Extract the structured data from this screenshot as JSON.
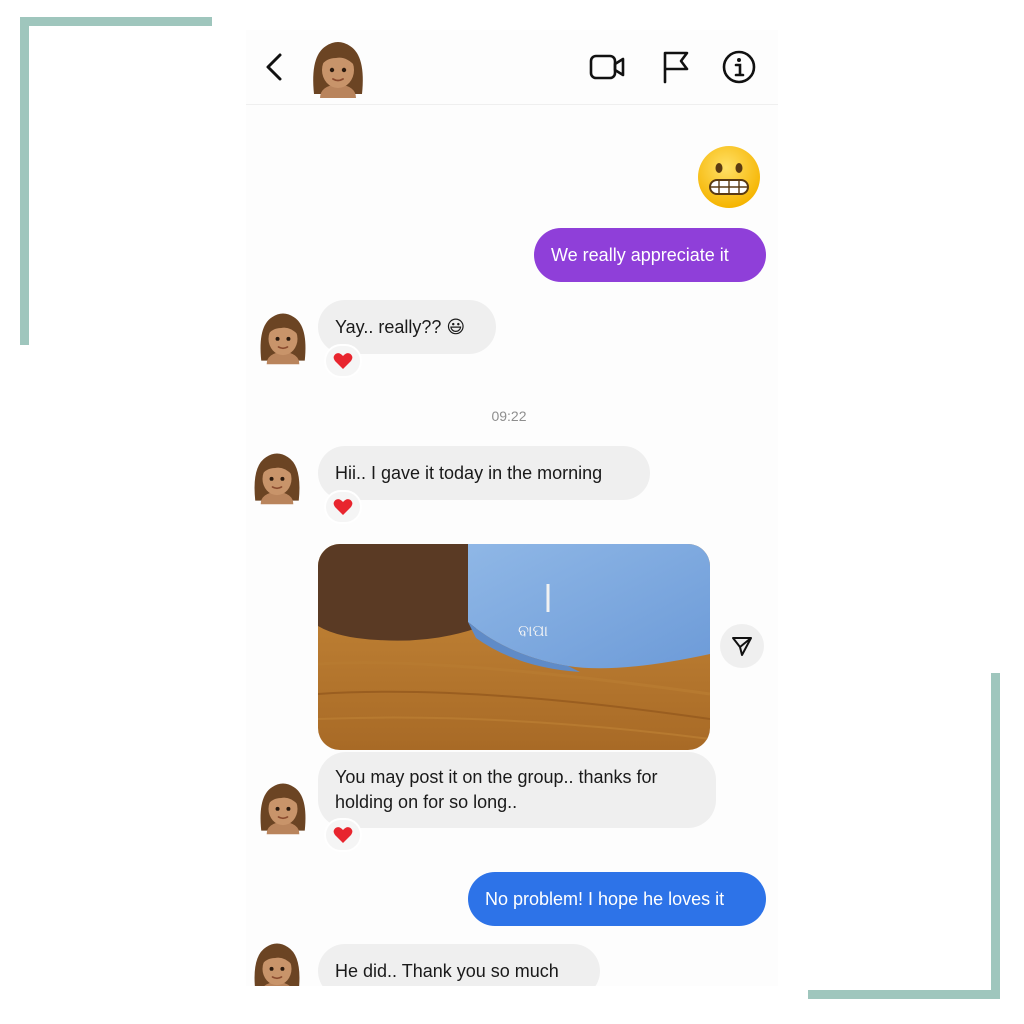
{
  "colors": {
    "frame": "#9fc6bd",
    "purple_bubble": "#8f3fd9",
    "blue_bubble": "#2d73e8",
    "incoming_bubble": "#efefef",
    "heart": "#e8252e"
  },
  "header": {
    "back_icon": "chevron-left-icon",
    "video_icon": "video-camera-icon",
    "flag_icon": "flag-icon",
    "info_icon": "info-icon"
  },
  "messages": [
    {
      "direction": "outgoing",
      "kind": "emoji",
      "emoji": "grimacing-face"
    },
    {
      "direction": "outgoing",
      "text": "We really appreciate it"
    },
    {
      "direction": "incoming",
      "text": "Yay.. really?? 😃",
      "reaction": "❤️"
    },
    {
      "direction": "incoming",
      "text": "Hii.. I gave it today in the morning",
      "reaction": "❤️"
    },
    {
      "direction": "incoming",
      "kind": "photo",
      "photo": "shirt-cuff-with-cufflink"
    },
    {
      "direction": "incoming",
      "text": "You may post it on the group.. thanks for holding on for so long..",
      "reaction": "❤️"
    },
    {
      "direction": "outgoing",
      "text": "No problem! I hope he loves it"
    },
    {
      "direction": "incoming",
      "text": "He did.. Thank you so much"
    }
  ],
  "timestamp": "09:22",
  "photo_cufflink_text": "ବାପା"
}
